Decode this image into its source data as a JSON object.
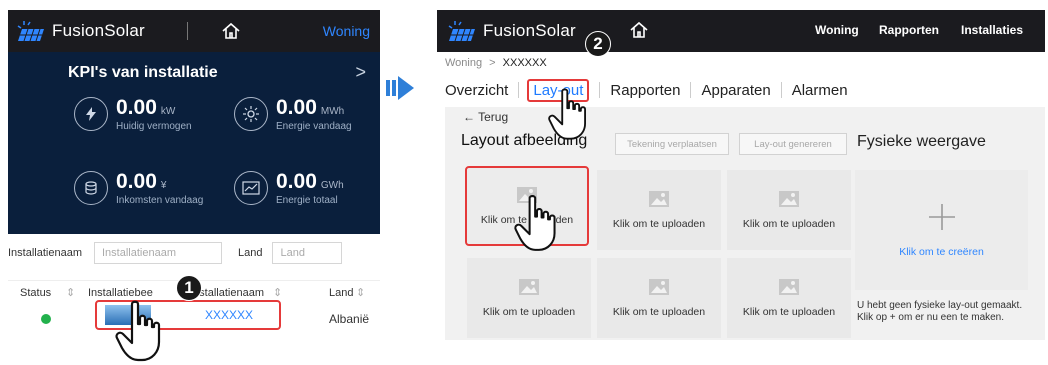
{
  "left": {
    "logo_name": "FusionSolar",
    "nav_woning": "Woning",
    "kpi_title": "KPI's van installatie",
    "kpi_chevron": ">",
    "metrics": [
      {
        "value": "0.00",
        "unit": "kW",
        "label": "Huidig vermogen",
        "icon": "lightning-icon"
      },
      {
        "value": "0.00",
        "unit": "MWh",
        "label": "Energie vandaag",
        "icon": "sun-panel-icon"
      },
      {
        "value": "0.00",
        "unit": "¥",
        "label": "Inkomsten vandaag",
        "icon": "coins-icon"
      },
      {
        "value": "0.00",
        "unit": "GWh",
        "label": "Energie totaal",
        "icon": "chart-icon"
      }
    ],
    "filter_name_label": "Installatienaam",
    "filter_name_placeholder": "Installatienaam",
    "filter_country_label": "Land",
    "filter_country_placeholder": "Land",
    "columns": [
      "Status",
      "Installatiebee",
      "Installatienaam",
      "Land"
    ],
    "row": {
      "name": "XXXXXX",
      "country": "Albanië",
      "status_color": "#22b14c"
    },
    "step": "1"
  },
  "right": {
    "logo_name": "FusionSolar",
    "nav": [
      "Woning",
      "Rapporten",
      "Installaties"
    ],
    "breadcrumb_home": "Woning",
    "breadcrumb_sep": ">",
    "breadcrumb_current": "XXXXXX",
    "tabs": [
      "Overzicht",
      "Lay-out",
      "Rapporten",
      "Apparaten",
      "Alarmen"
    ],
    "active_tab": "Lay-out",
    "back": "← Terug",
    "layout_title": "Layout afbeelding",
    "btn_move": "Tekening verplaatsen",
    "btn_generate": "Lay-out genereren",
    "physical_title": "Fysieke weergave",
    "upload_caption": "Klik om te uploaden",
    "create_caption": "Klik om te creëren",
    "hint_line1": "U hebt geen fysieke lay-out gemaakt.",
    "hint_line2": "Klik op + om er nu een te maken.",
    "step": "2"
  },
  "colors": {
    "accent": "#2f86ff",
    "highlight": "#e53a3a",
    "kpi_bg": "#0a1f3c",
    "topbar_bg": "#1b1b1f",
    "arrow": "#2e7fd8"
  }
}
